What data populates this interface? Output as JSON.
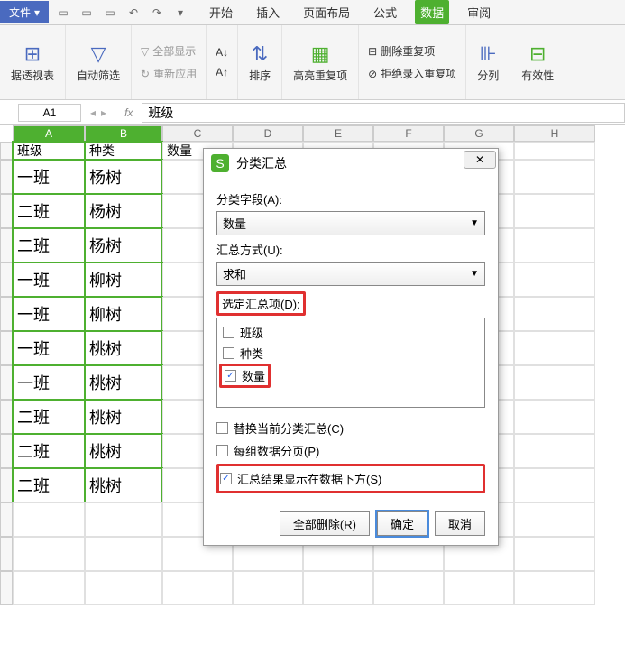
{
  "titlebar": {
    "file_menu": "文件",
    "tabs": [
      "开始",
      "插入",
      "页面布局",
      "公式",
      "数据",
      "审阅"
    ],
    "active_tab_index": 4
  },
  "ribbon": {
    "pivot": "据透视表",
    "autofilter": "自动筛选",
    "show_all": "全部显示",
    "reapply": "重新应用",
    "sort_asc": "A↓",
    "sort_desc": "A↑",
    "sort": "排序",
    "highlight_dup": "高亮重复项",
    "remove_dup": "删除重复项",
    "reject_dup": "拒绝录入重复项",
    "text_to_cols": "分列",
    "validation": "有效性"
  },
  "formula_bar": {
    "name_box": "A1",
    "fx": "fx",
    "value": "班级"
  },
  "columns": [
    "A",
    "B",
    "C",
    "D",
    "E",
    "F",
    "G",
    "H"
  ],
  "headers": {
    "col1": "班级",
    "col2": "种类",
    "col3": "数量"
  },
  "rows": [
    {
      "c1": "一班",
      "c2": "杨树"
    },
    {
      "c1": "二班",
      "c2": "杨树"
    },
    {
      "c1": "二班",
      "c2": "杨树"
    },
    {
      "c1": "一班",
      "c2": "柳树"
    },
    {
      "c1": "一班",
      "c2": "柳树"
    },
    {
      "c1": "一班",
      "c2": "桃树"
    },
    {
      "c1": "一班",
      "c2": "桃树"
    },
    {
      "c1": "二班",
      "c2": "桃树"
    },
    {
      "c1": "二班",
      "c2": "桃树"
    },
    {
      "c1": "二班",
      "c2": "桃树"
    }
  ],
  "dialog": {
    "title": "分类汇总",
    "close": "✕",
    "field_label": "分类字段(A):",
    "field_value": "数量",
    "method_label": "汇总方式(U):",
    "method_value": "求和",
    "items_label": "选定汇总项(D):",
    "items": [
      {
        "label": "班级",
        "checked": false
      },
      {
        "label": "种类",
        "checked": false
      },
      {
        "label": "数量",
        "checked": true
      }
    ],
    "opt_replace": "替换当前分类汇总(C)",
    "opt_page": "每组数据分页(P)",
    "opt_below": "汇总结果显示在数据下方(S)",
    "btn_remove": "全部删除(R)",
    "btn_ok": "确定",
    "btn_cancel": "取消"
  }
}
